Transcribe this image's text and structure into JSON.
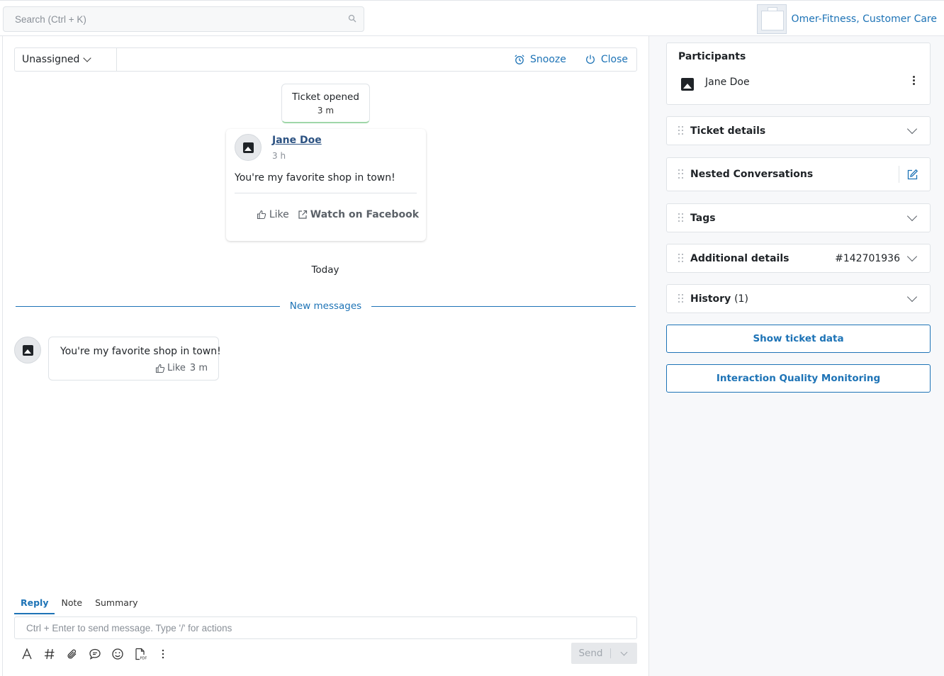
{
  "search": {
    "placeholder": "Search (Ctrl + K)"
  },
  "brand": {
    "name": "Omer-Fitness, Customer Care"
  },
  "actionbar": {
    "assignee": "Unassigned",
    "snooze_label": "Snooze",
    "close_label": "Close"
  },
  "timeline": {
    "ticket_opened": {
      "label": "Ticket opened",
      "time": "3 m"
    },
    "post": {
      "author": "Jane Doe",
      "time": "3 h",
      "text": "You're my favorite shop in town!",
      "like_label": "Like",
      "watch_label": "Watch on Facebook"
    },
    "day_separator": "Today",
    "new_messages_label": "New messages",
    "message": {
      "text": "You're my favorite shop in town!",
      "like_label": "Like",
      "time": "3 m"
    }
  },
  "reply": {
    "tabs": [
      "Reply",
      "Note",
      "Summary"
    ],
    "active_tab": "Reply",
    "placeholder": "Ctrl + Enter to send message. Type '/' for actions",
    "send_label": "Send"
  },
  "sidebar": {
    "participants": {
      "title": "Participants",
      "items": [
        "Jane Doe"
      ]
    },
    "panels": {
      "ticket_details": "Ticket details",
      "nested_conversations": "Nested Conversations",
      "tags": "Tags",
      "additional_details": {
        "title": "Additional details",
        "id": "#142701936"
      },
      "history": {
        "title": "History",
        "count": "(1)"
      }
    },
    "buttons": {
      "show_ticket_data": "Show ticket data",
      "iqm": "Interaction Quality Monitoring"
    }
  },
  "colors": {
    "accent": "#1d73b6",
    "ticket_open_border": "#9fd6a8"
  }
}
